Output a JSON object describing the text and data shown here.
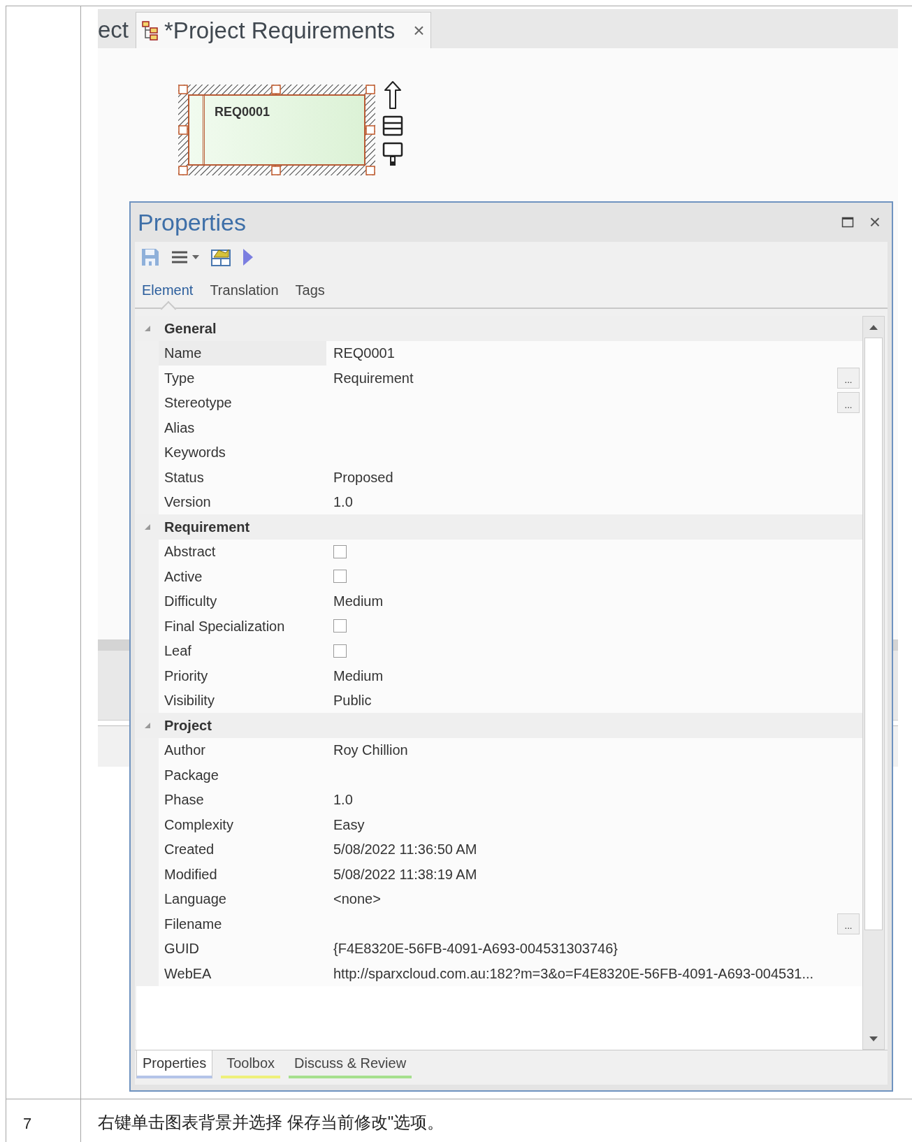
{
  "document": {
    "step": "7",
    "instruction": "右键单击图表背景并选择 保存当前修改\"选项。"
  },
  "diagram_tabs": [
    {
      "label": "ect",
      "selected": false,
      "icon": false
    },
    {
      "label": "*Project Requirements",
      "selected": true,
      "icon": true,
      "close": "×"
    }
  ],
  "element": {
    "name": "REQ0001",
    "selected": true
  },
  "properties": {
    "title": "Properties",
    "close": "×",
    "tabs": [
      {
        "label": "Element",
        "selected": true
      },
      {
        "label": "Translation",
        "selected": false
      },
      {
        "label": "Tags",
        "selected": false
      }
    ],
    "sections": [
      {
        "title": "General",
        "expanded": true,
        "rows": [
          {
            "kind": "text",
            "label": "Name",
            "value": "REQ0001",
            "selected": true
          },
          {
            "kind": "text",
            "label": "Type",
            "value": "Requirement",
            "selected": false,
            "button": "..."
          },
          {
            "kind": "text",
            "label": "Stereotype",
            "selected": false,
            "button": "..."
          },
          {
            "kind": "text",
            "label": "Alias",
            "selected": false
          },
          {
            "kind": "text",
            "label": "Keywords",
            "selected": false
          },
          {
            "kind": "text",
            "label": "Status",
            "value": "Proposed",
            "selected": false
          },
          {
            "kind": "text",
            "label": "Version",
            "value": "1.0",
            "selected": false
          }
        ]
      },
      {
        "title": "Requirement",
        "expanded": true,
        "rows": [
          {
            "kind": "checkbox",
            "label": "Abstract",
            "checked": false,
            "selected": false
          },
          {
            "kind": "checkbox",
            "label": "Active",
            "checked": false,
            "selected": false
          },
          {
            "kind": "text",
            "label": "Difficulty",
            "value": "Medium",
            "selected": false
          },
          {
            "kind": "checkbox",
            "label": "Final Specialization",
            "checked": false,
            "selected": false
          },
          {
            "kind": "checkbox",
            "label": "Leaf",
            "checked": false,
            "selected": false
          },
          {
            "kind": "text",
            "label": "Priority",
            "value": "Medium",
            "selected": false
          },
          {
            "kind": "text",
            "label": "Visibility",
            "value": "Public",
            "selected": false
          }
        ]
      },
      {
        "title": "Project",
        "expanded": true,
        "rows": [
          {
            "kind": "text",
            "label": "Author",
            "value": "Roy Chillion",
            "selected": false
          },
          {
            "kind": "text",
            "label": "Package",
            "selected": false
          },
          {
            "kind": "text",
            "label": "Phase",
            "value": "1.0",
            "selected": false
          },
          {
            "kind": "text",
            "label": "Complexity",
            "value": "Easy",
            "selected": false
          },
          {
            "kind": "text",
            "label": "Created",
            "value": "5/08/2022 11:36:50 AM",
            "selected": false
          },
          {
            "kind": "text",
            "label": "Modified",
            "value": "5/08/2022 11:38:19 AM",
            "selected": false
          },
          {
            "kind": "text",
            "label": "Language",
            "value": "<none>",
            "selected": false
          },
          {
            "kind": "text",
            "label": "Filename",
            "selected": false,
            "button": "..."
          },
          {
            "kind": "text",
            "label": "GUID",
            "value": "{F4E8320E-56FB-4091-A693-004531303746}",
            "selected": false
          },
          {
            "kind": "text",
            "label": "WebEA",
            "value": "http://sparxcloud.com.au:182?m=3&o=F4E8320E-56FB-4091-A693-004531...",
            "selected": false
          }
        ]
      }
    ],
    "bottom_tabs": [
      {
        "label": "Properties",
        "selected": true,
        "color": "#b4c4e8"
      },
      {
        "label": "Toolbox",
        "selected": false,
        "color": "#eef07a"
      },
      {
        "label": "Discuss & Review",
        "selected": false,
        "color": "#a6e08e"
      }
    ]
  }
}
